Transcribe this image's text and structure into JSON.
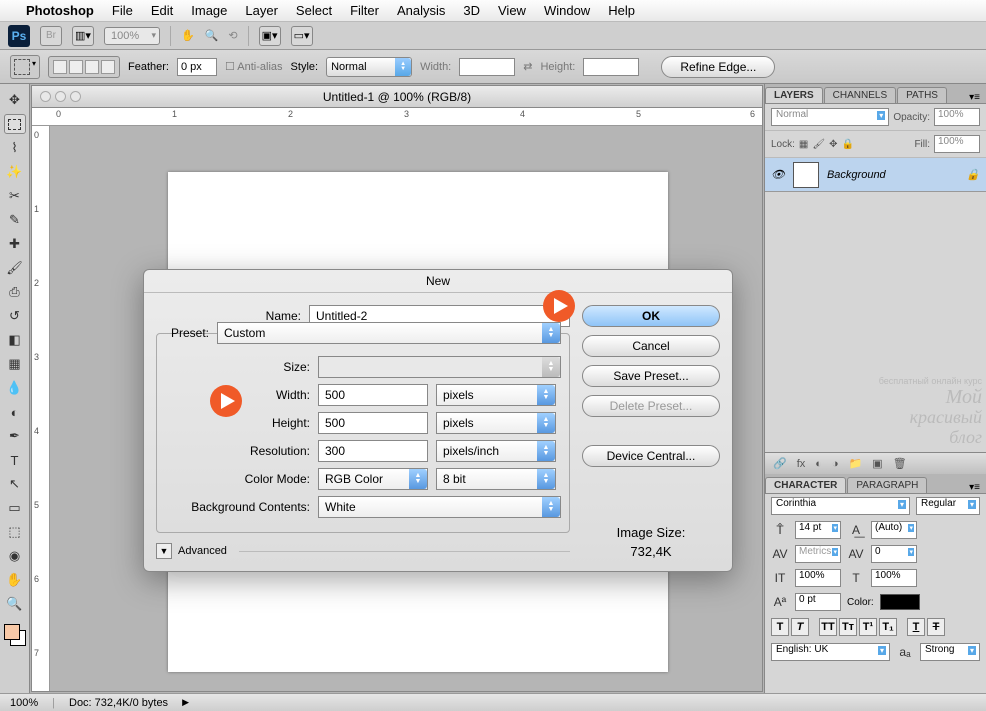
{
  "menubar": {
    "app": "Photoshop",
    "items": [
      "File",
      "Edit",
      "Image",
      "Layer",
      "Select",
      "Filter",
      "Analysis",
      "3D",
      "View",
      "Window",
      "Help"
    ]
  },
  "toolbar1": {
    "zoom": "100%"
  },
  "toolbar2": {
    "feather_label": "Feather:",
    "feather": "0 px",
    "antialias": "Anti-alias",
    "style_label": "Style:",
    "style": "Normal",
    "width_label": "Width:",
    "height_label": "Height:",
    "refine": "Refine Edge..."
  },
  "document": {
    "title": "Untitled-1 @ 100% (RGB/8)"
  },
  "dialog": {
    "title": "New",
    "name_label": "Name:",
    "name": "Untitled-2",
    "preset_label": "Preset:",
    "preset": "Custom",
    "size_label": "Size:",
    "size": "",
    "width_label": "Width:",
    "width": "500",
    "width_unit": "pixels",
    "height_label": "Height:",
    "height": "500",
    "height_unit": "pixels",
    "res_label": "Resolution:",
    "res": "300",
    "res_unit": "pixels/inch",
    "mode_label": "Color Mode:",
    "mode": "RGB Color",
    "depth": "8 bit",
    "bg_label": "Background Contents:",
    "bg": "White",
    "advanced": "Advanced",
    "ok": "OK",
    "cancel": "Cancel",
    "save_preset": "Save Preset...",
    "delete_preset": "Delete Preset...",
    "device_central": "Device Central...",
    "image_size_label": "Image Size:",
    "image_size": "732,4K"
  },
  "layers": {
    "tabs": [
      "LAYERS",
      "CHANNELS",
      "PATHS"
    ],
    "blend": "Normal",
    "opacity_label": "Opacity:",
    "opacity": "100%",
    "lock_label": "Lock:",
    "fill_label": "Fill:",
    "fill": "100%",
    "layer_name": "Background"
  },
  "character": {
    "tabs": [
      "CHARACTER",
      "PARAGRAPH"
    ],
    "font": "Corinthia",
    "weight": "Regular",
    "size": "14 pt",
    "leading": "(Auto)",
    "kerning": "Metrics",
    "tracking": "0",
    "vscale": "100%",
    "hscale": "100%",
    "baseline": "0 pt",
    "color_label": "Color:",
    "lang": "English: UK",
    "aa": "Strong"
  },
  "statusbar": {
    "zoom": "100%",
    "doc": "Doc: 732,4K/0 bytes"
  },
  "watermark": {
    "line1": "бесплатный онлайн курс",
    "line2": "Мой",
    "line3": "красивый",
    "line4": "блог"
  },
  "ruler": {
    "h": [
      "0",
      "1",
      "2",
      "3",
      "4",
      "5",
      "6"
    ],
    "v": [
      "0",
      "1",
      "2",
      "3",
      "4",
      "5",
      "6",
      "7"
    ]
  }
}
